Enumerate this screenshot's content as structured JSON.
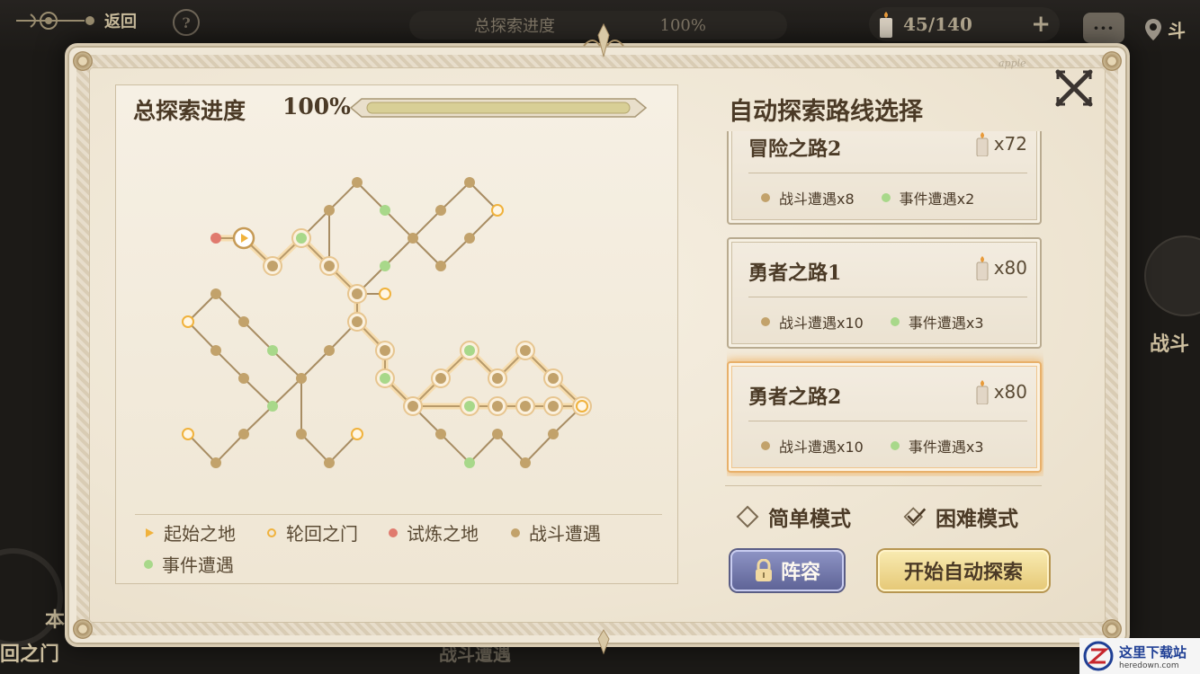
{
  "hud": {
    "back_label": "返回",
    "help_symbol": "?",
    "bg_progress_label": "总探索进度",
    "bg_progress_value": "100%",
    "candle_count": "45/140",
    "plus_symbol": "+",
    "chat_symbol": "···",
    "location_label": "斗",
    "right_side_label": "战斗",
    "left_side_label_1": "本",
    "left_side_label_2": "回之门",
    "bottom_label": "战斗遭遇"
  },
  "modal": {
    "progress_title": "总探索进度",
    "progress_value": "100%",
    "progress_fraction": 1.0,
    "close_label": "关闭",
    "mark": "apple",
    "route_title": "自动探索路线选择"
  },
  "legend": {
    "start": "起始之地",
    "portal": "轮回之门",
    "trial": "试炼之地",
    "battle": "战斗遭遇",
    "event": "事件遭遇"
  },
  "routes": [
    {
      "name": "冒险之路2",
      "cost": "x72",
      "battle": "战斗遭遇x8",
      "event": "事件遭遇x2",
      "selected": false
    },
    {
      "name": "勇者之路1",
      "cost": "x80",
      "battle": "战斗遭遇x10",
      "event": "事件遭遇x3",
      "selected": false
    },
    {
      "name": "勇者之路2",
      "cost": "x80",
      "battle": "战斗遭遇x10",
      "event": "事件遭遇x3",
      "selected": true
    }
  ],
  "modes": {
    "easy": "简单模式",
    "hard": "困难模式",
    "selected": "hard"
  },
  "buttons": {
    "lineup": "阵容",
    "start_auto": "开始自动探索"
  },
  "watermark": {
    "cn": "这里下载站",
    "en": "heredown.com"
  },
  "colors": {
    "battle_node": "#c2a26b",
    "event_node": "#a8d88a",
    "trial_node": "#e07a6e",
    "start_node": "#f0b23c",
    "highlight_path": "#f7d9a2",
    "selected_card_glow": "#f0aa50",
    "lineup_button": "#6a6fa3",
    "start_button": "#eed58e"
  }
}
